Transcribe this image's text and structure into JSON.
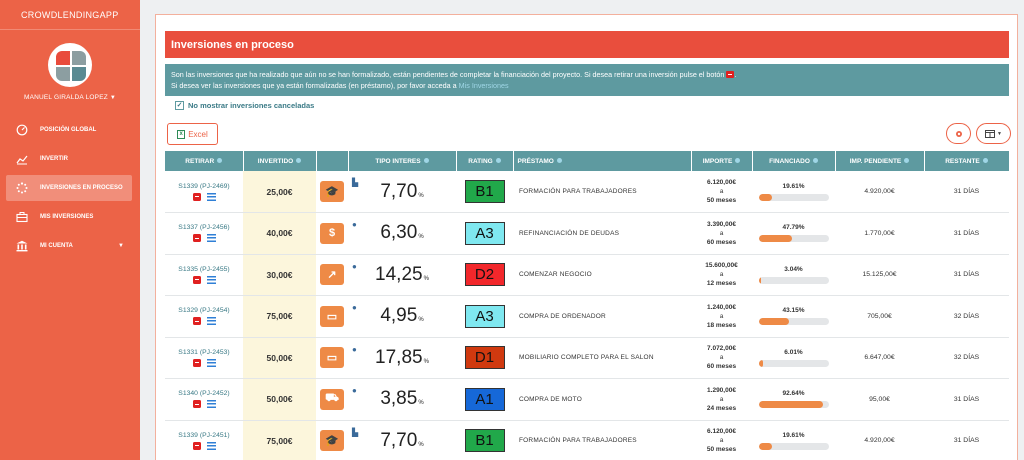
{
  "sidebar": {
    "brand": "CROWDLENDINGAPP",
    "username": "MANUEL GIRALDA LOPEZ",
    "items": [
      {
        "label": "POSICIÓN GLOBAL",
        "icon": "dashboard-gauge-icon",
        "active": false
      },
      {
        "label": "INVERTIR",
        "icon": "line-chart-icon",
        "active": false
      },
      {
        "label": "INVERSIONES EN PROCESO",
        "icon": "spinner-icon",
        "active": true
      },
      {
        "label": "MIS INVERSIONES",
        "icon": "briefcase-icon",
        "active": false
      },
      {
        "label": "MI CUENTA",
        "icon": "bank-icon",
        "active": false
      }
    ]
  },
  "main": {
    "title": "Inversiones en proceso",
    "info_line1": "Son las inversiones que ha realizado que aún no se han formalizado, están pendientes de completar la financiación del proyecto. Si desea retirar una inversión pulse el botón",
    "info_line1_end": ".",
    "info_line2": "Si desea ver las inversiones que ya están formalizadas (en préstamo), por favor acceda a",
    "info_link": "Mis Inversiones",
    "checkbox_label": "No mostrar inversiones canceladas",
    "excel_label": "Excel"
  },
  "table": {
    "headers": [
      "RETIRAR",
      "INVERTIDO",
      "",
      "TIPO INTERES",
      "RATING",
      "PRÉSTAMO",
      "IMPORTE",
      "FINANCIADO",
      "IMP. PENDIENTE",
      "RESTANTE"
    ],
    "a_label": "a",
    "rows": [
      {
        "id": "S1339 (PJ-2469)",
        "invertido": "25,00€",
        "cat_icon": "graduation-cap-icon",
        "cat_glyph": "🎓",
        "side_icon": "factory-icon",
        "side_glyph": "▙",
        "interes": "7,70",
        "pct": "%",
        "rating": "B1",
        "rating_color": "#21a84a",
        "prestamo": "FORMACIÓN PARA TRABAJADORES",
        "importe": "6.120,00€",
        "meses": "50 meses",
        "financiado": "19.61%",
        "fin_value": 19.61,
        "pendiente": "4.920,00€",
        "restante": "31 DÍAS"
      },
      {
        "id": "S1337 (PJ-2456)",
        "invertido": "40,00€",
        "cat_icon": "money-bill-icon",
        "cat_glyph": "$",
        "side_icon": "user-icon",
        "side_glyph": "●",
        "interes": "6,30",
        "pct": "%",
        "rating": "A3",
        "rating_color": "#7fe8f0",
        "prestamo": "REFINANCIACIÓN DE DEUDAS",
        "importe": "3.390,00€",
        "meses": "60 meses",
        "financiado": "47.79%",
        "fin_value": 47.79,
        "pendiente": "1.770,00€",
        "restante": "31 DÍAS"
      },
      {
        "id": "S1335 (PJ-2455)",
        "invertido": "30,00€",
        "cat_icon": "area-chart-icon",
        "cat_glyph": "↗",
        "side_icon": "user-icon",
        "side_glyph": "●",
        "interes": "14,25",
        "pct": "%",
        "rating": "D2",
        "rating_color": "#f2272b",
        "prestamo": "COMENZAR NEGOCIO",
        "importe": "15.600,00€",
        "meses": "12 meses",
        "financiado": "3.04%",
        "fin_value": 3.04,
        "pendiente": "15.125,00€",
        "restante": "31 DÍAS"
      },
      {
        "id": "S1329 (PJ-2454)",
        "invertido": "75,00€",
        "cat_icon": "laptop-icon",
        "cat_glyph": "▭",
        "side_icon": "user-icon",
        "side_glyph": "●",
        "interes": "4,95",
        "pct": "%",
        "rating": "A3",
        "rating_color": "#7fe8f0",
        "prestamo": "COMPRA DE ORDENADOR",
        "importe": "1.240,00€",
        "meses": "18 meses",
        "financiado": "43.15%",
        "fin_value": 43.15,
        "pendiente": "705,00€",
        "restante": "32 DÍAS"
      },
      {
        "id": "S1331 (PJ-2453)",
        "invertido": "50,00€",
        "cat_icon": "laptop-icon",
        "cat_glyph": "▭",
        "side_icon": "user-icon",
        "side_glyph": "●",
        "interes": "17,85",
        "pct": "%",
        "rating": "D1",
        "rating_color": "#d0390f",
        "prestamo": "MOBILIARIO COMPLETO PARA EL SALON",
        "importe": "7.072,00€",
        "meses": "60 meses",
        "financiado": "6.01%",
        "fin_value": 6.01,
        "pendiente": "6.647,00€",
        "restante": "32 DÍAS"
      },
      {
        "id": "S1340 (PJ-2452)",
        "invertido": "50,00€",
        "cat_icon": "car-icon",
        "cat_glyph": "⛟",
        "side_icon": "user-icon",
        "side_glyph": "●",
        "interes": "3,85",
        "pct": "%",
        "rating": "A1",
        "rating_color": "#1668d8",
        "prestamo": "COMPRA DE MOTO",
        "importe": "1.290,00€",
        "meses": "24 meses",
        "financiado": "92.64%",
        "fin_value": 92.64,
        "pendiente": "95,00€",
        "restante": "31 DÍAS"
      },
      {
        "id": "S1339 (PJ-2451)",
        "invertido": "75,00€",
        "cat_icon": "graduation-cap-icon",
        "cat_glyph": "🎓",
        "side_icon": "factory-icon",
        "side_glyph": "▙",
        "interes": "7,70",
        "pct": "%",
        "rating": "B1",
        "rating_color": "#21a84a",
        "prestamo": "FORMACIÓN PARA TRABAJADORES",
        "importe": "6.120,00€",
        "meses": "50 meses",
        "financiado": "19.61%",
        "fin_value": 19.61,
        "pendiente": "4.920,00€",
        "restante": "31 DÍAS"
      }
    ]
  },
  "colors": {
    "sidebar": "#ec6347",
    "title_bar": "#e94e3d",
    "info_box": "#5e9aa0",
    "accent_orange": "#ee8a46"
  }
}
